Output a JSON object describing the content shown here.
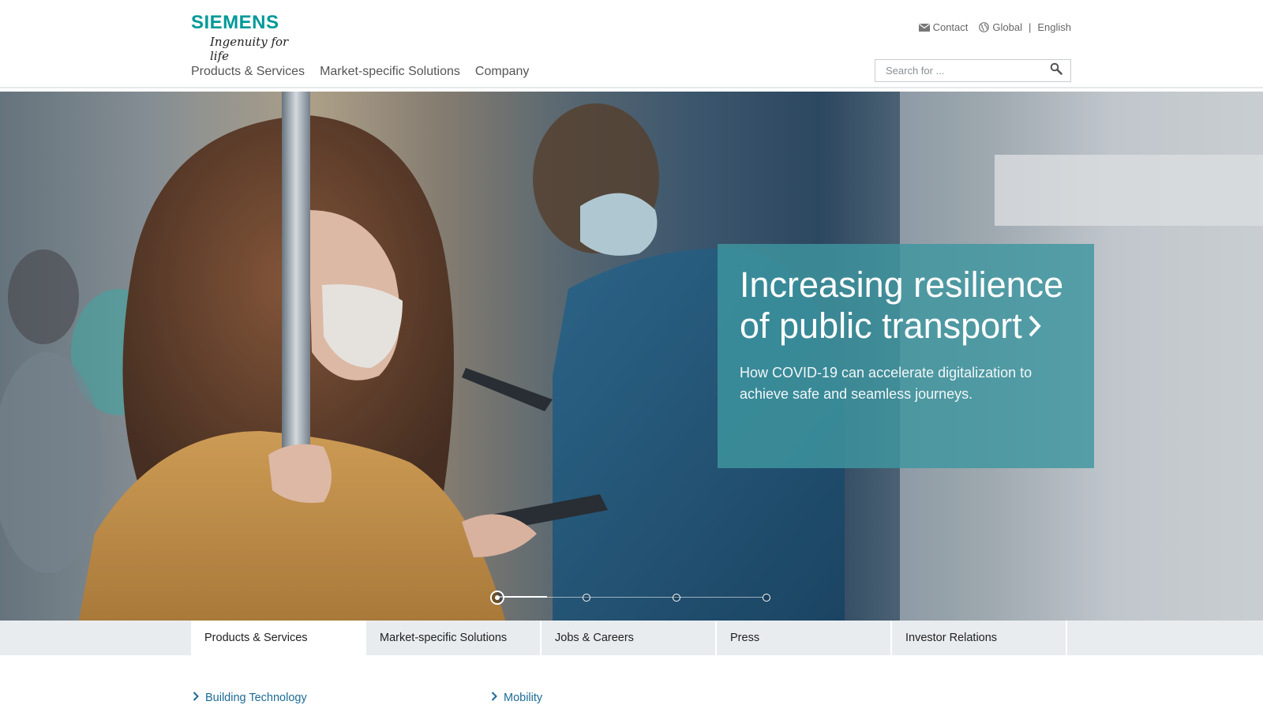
{
  "brand": {
    "name": "SIEMENS",
    "tagline": "Ingenuity for life",
    "color": "#009999"
  },
  "meta": {
    "contact_label": "Contact",
    "region_label": "Global",
    "separator": "|",
    "language_label": "English"
  },
  "nav": {
    "items": [
      {
        "label": "Products & Services"
      },
      {
        "label": "Market-specific Solutions"
      },
      {
        "label": "Company"
      }
    ]
  },
  "search": {
    "placeholder": "Search for ...",
    "value": ""
  },
  "hero": {
    "title": "Increasing resilience of public transport",
    "chevron": "›",
    "subtitle": "How COVID-19 can accelerate digitalization to achieve safe and seamless journeys.",
    "caption_color": "#3e96a0",
    "slides_total": 4,
    "active_slide": 1
  },
  "tabs": [
    {
      "label": "Products & Services",
      "active": true
    },
    {
      "label": "Market-specific Solutions",
      "active": false
    },
    {
      "label": "Jobs & Careers",
      "active": false
    },
    {
      "label": "Press",
      "active": false
    },
    {
      "label": "Investor Relations",
      "active": false
    }
  ],
  "links": [
    {
      "label": "Building Technology"
    },
    {
      "label": "Mobility"
    }
  ],
  "icons": {
    "contact": "envelope-icon",
    "region": "globe-icon",
    "search": "search-icon",
    "link": "chevron-right-icon"
  }
}
